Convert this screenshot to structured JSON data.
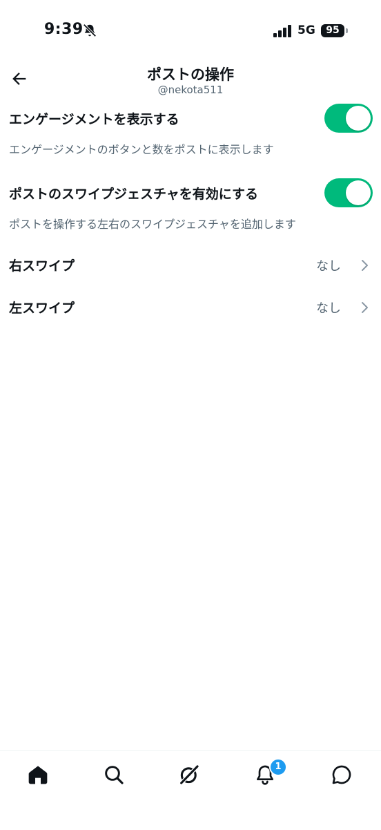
{
  "status_bar": {
    "time": "9:39",
    "network": "5G",
    "battery": "95",
    "icons": [
      "bell-slash-icon",
      "signal-bars-icon",
      "battery-icon"
    ]
  },
  "header": {
    "title": "ポストの操作",
    "subtitle": "@nekota511",
    "back_icon": "arrow-left-icon"
  },
  "settings": [
    {
      "title": "エンゲージメントを表示する",
      "description": "エンゲージメントのボタンと数をポストに表示します",
      "enabled": true
    },
    {
      "title": "ポストのスワイプジェスチャを有効にする",
      "description": "ポストを操作する左右のスワイプジェスチャを追加します",
      "enabled": true
    }
  ],
  "swipe_rows": [
    {
      "label": "右スワイプ",
      "value": "なし"
    },
    {
      "label": "左スワイプ",
      "value": "なし"
    }
  ],
  "tab_bar": {
    "tabs": [
      "home-icon",
      "search-icon",
      "grok-icon",
      "notifications-icon",
      "messages-icon"
    ],
    "notification_count": "1",
    "active_tab": "home-icon"
  },
  "colors": {
    "toggle_on": "#00ba7c",
    "text_primary": "#0f1419",
    "text_secondary": "#536471",
    "badge": "#1d9bf0"
  }
}
